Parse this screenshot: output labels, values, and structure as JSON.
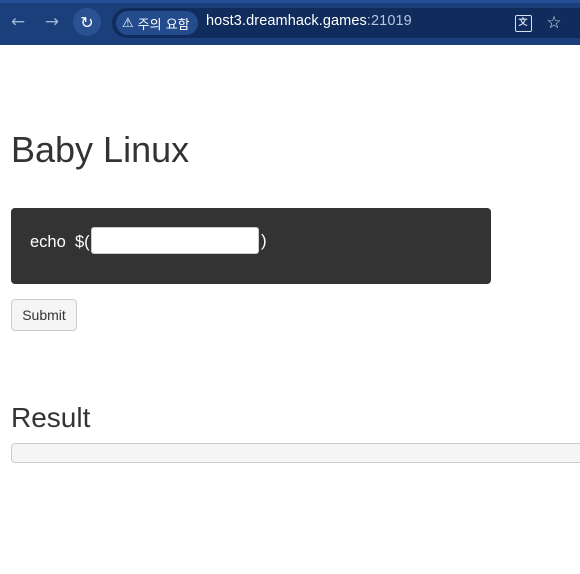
{
  "browser": {
    "back_icon": "←",
    "forward_icon": "→",
    "reload_icon": "↻",
    "security_warning_icon": "⚠",
    "security_label": "주의 요함",
    "url_host": "host3.dreamhack.games",
    "url_port": ":21019",
    "translate_icon": "文",
    "bookmark_icon": "☆"
  },
  "page": {
    "title": "Baby Linux",
    "form": {
      "prefix": "echo  $(",
      "input_value": "",
      "input_placeholder": "",
      "suffix": ")",
      "submit_label": "Submit"
    },
    "result": {
      "title": "Result",
      "output": ""
    }
  },
  "colors": {
    "toolbar_bg": "#1a3f7a",
    "panel_bg": "#333333",
    "text": "#333333"
  }
}
